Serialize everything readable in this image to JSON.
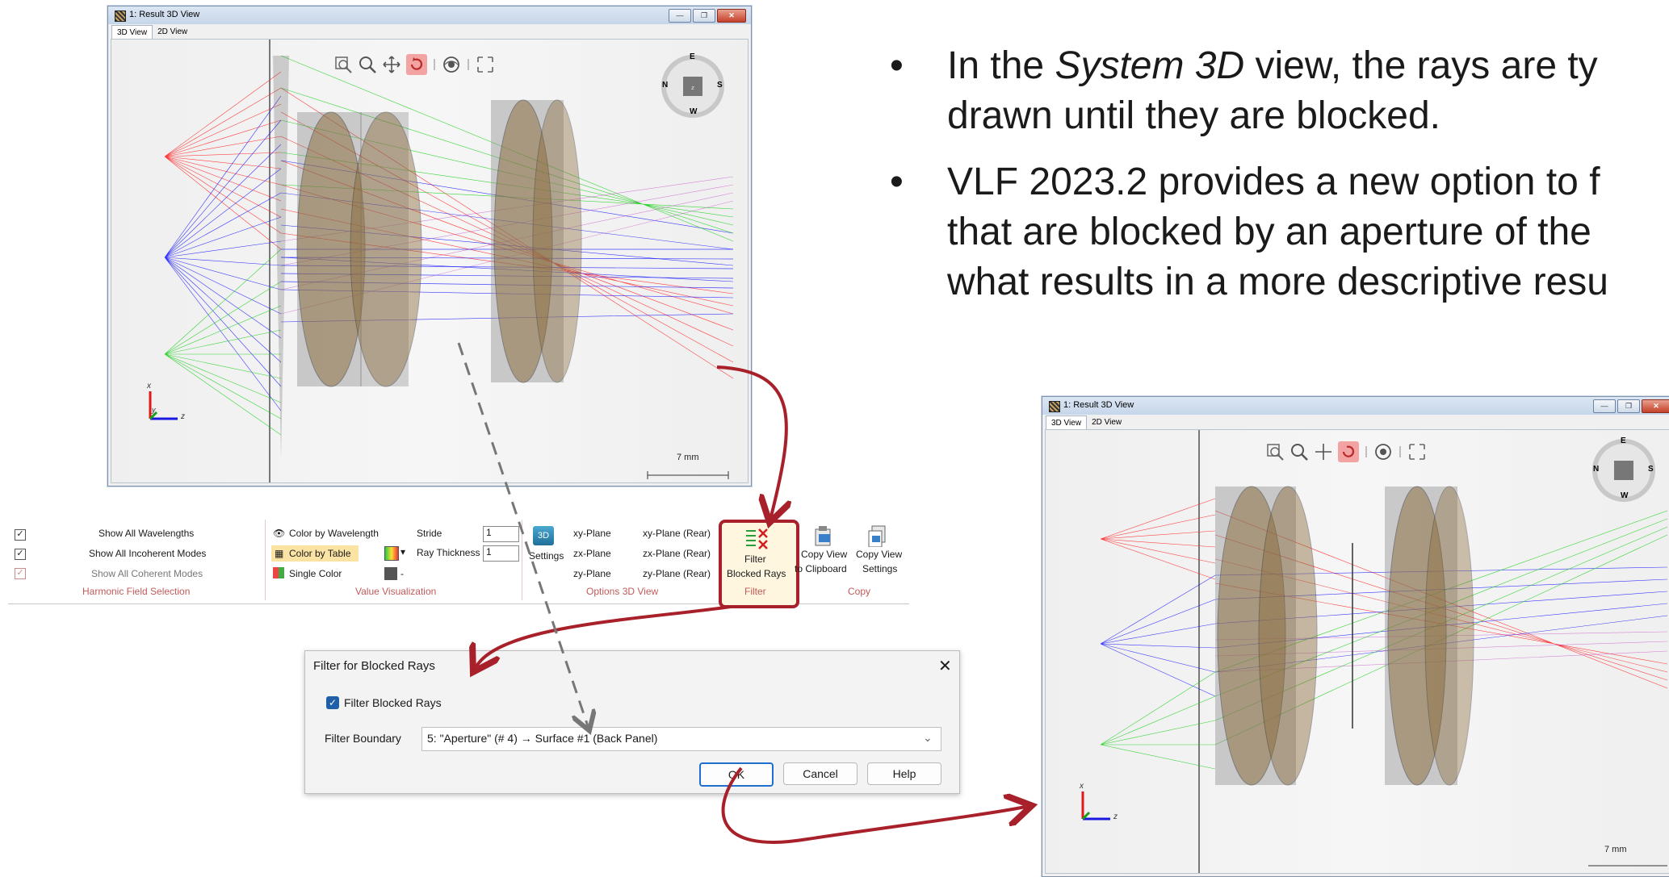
{
  "window1": {
    "title": "1: Result 3D View",
    "tabs": [
      "3D View",
      "2D View"
    ],
    "scale_label": "7 mm"
  },
  "window2": {
    "title": "1: Result 3D View",
    "tabs": [
      "3D View",
      "2D View"
    ],
    "scale_label": "7 mm"
  },
  "bullets": [
    {
      "prefix": "In the ",
      "em": "System 3D",
      "suffix": " view, the rays are ty"
    },
    {
      "line2": "drawn until they are blocked."
    },
    {
      "line1": "VLF 2023.2 provides a new option to f"
    },
    {
      "line2": "that are blocked by an aperture of the"
    },
    {
      "line3": "what results in a more descriptive resu"
    }
  ],
  "compass": {
    "top": "E",
    "left": "N",
    "right": "S",
    "bottom": "W"
  },
  "ribbon": {
    "harmonic": {
      "items": [
        "Show All Wavelengths",
        "Show All Incoherent Modes",
        "Show All Coherent Modes"
      ],
      "group": "Harmonic Field Selection"
    },
    "value_vis": {
      "items": [
        "Color by Wavelength",
        "Color by Table",
        "Single Color"
      ],
      "stride_label": "Stride",
      "stride_value": "1",
      "ray_thickness_label": "Ray Thickness",
      "ray_thickness_value": "1",
      "group": "Value Visualization"
    },
    "options3d": {
      "settings_label": "Settings",
      "planes": [
        "xy-Plane",
        "xy-Plane (Rear)",
        "zx-Plane",
        "zx-Plane (Rear)",
        "zy-Plane",
        "zy-Plane (Rear)"
      ],
      "group": "Options 3D View"
    },
    "filter": {
      "label1": "Filter",
      "label2": "Blocked Rays",
      "group": "Filter"
    },
    "copy": {
      "view_label1": "Copy View",
      "view_label2": "to Clipboard",
      "settings_label1": "Copy View",
      "settings_label2": "Settings",
      "group": "Copy"
    }
  },
  "dialog": {
    "title": "Filter for Blocked Rays",
    "checkbox_label": "Filter Blocked Rays",
    "boundary_label": "Filter Boundary",
    "boundary_value": "5: \"Aperture\" (# 4) → Surface #1 (Back Panel)",
    "ok": "OK",
    "cancel": "Cancel",
    "help": "Help"
  },
  "colors": {
    "accent": "#a8202a",
    "red_ray": "#ff2020",
    "green_ray": "#18d018",
    "blue_ray": "#1818ff",
    "magenta_ray": "#d040c8"
  }
}
